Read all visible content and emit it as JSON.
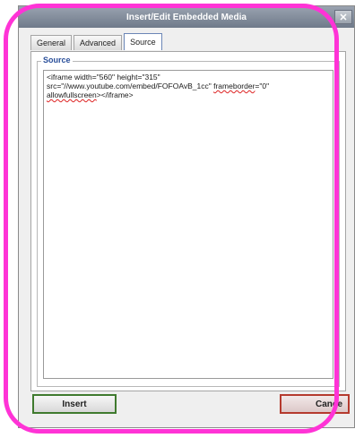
{
  "window": {
    "title": "Insert/Edit Embedded Media",
    "close_glyph": "✕"
  },
  "tabs": [
    {
      "label": "General",
      "active": false
    },
    {
      "label": "Advanced",
      "active": false
    },
    {
      "label": "Source",
      "active": true
    }
  ],
  "source_section": {
    "legend": "Source",
    "code_part1": "<iframe width=\"560\" height=\"315\"\nsrc=\"//www.youtube.com/embed/FOFOAvB_1cc\" ",
    "code_frameborder": "frameborder",
    "code_part2": "=\"0\"\n",
    "code_allowfullscreen": "allowfullscreen",
    "code_part3": "></iframe>"
  },
  "buttons": {
    "insert": "Insert",
    "cancel": "Cance"
  },
  "colors": {
    "highlight": "#ff33d6",
    "insert_border": "#3f7a2e",
    "cancel_border": "#b53a2e",
    "legend_text": "#2a4f9a"
  }
}
